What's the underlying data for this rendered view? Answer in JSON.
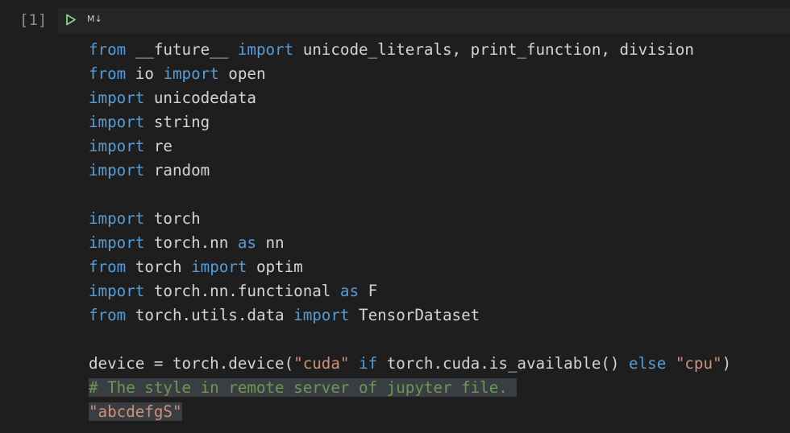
{
  "cell": {
    "execution_count": "[1]",
    "run_icon": "play-icon",
    "cell_type_label": "M↓",
    "colors": {
      "keyword": "#569cd6",
      "string": "#ce9178",
      "comment": "#6a9955",
      "text": "#d4d4d4"
    },
    "lines": [
      {
        "selected": false,
        "tokens": [
          {
            "t": "from",
            "k": "kw"
          },
          {
            "t": " __future__ ",
            "k": ""
          },
          {
            "t": "import",
            "k": "kw"
          },
          {
            "t": " unicode_literals, print_function, division",
            "k": ""
          }
        ]
      },
      {
        "selected": false,
        "tokens": [
          {
            "t": "from",
            "k": "kw"
          },
          {
            "t": " io ",
            "k": ""
          },
          {
            "t": "import",
            "k": "kw"
          },
          {
            "t": " open",
            "k": ""
          }
        ]
      },
      {
        "selected": false,
        "tokens": [
          {
            "t": "import",
            "k": "kw"
          },
          {
            "t": " unicodedata",
            "k": ""
          }
        ]
      },
      {
        "selected": false,
        "tokens": [
          {
            "t": "import",
            "k": "kw"
          },
          {
            "t": " string",
            "k": ""
          }
        ]
      },
      {
        "selected": false,
        "tokens": [
          {
            "t": "import",
            "k": "kw"
          },
          {
            "t": " re",
            "k": ""
          }
        ]
      },
      {
        "selected": false,
        "tokens": [
          {
            "t": "import",
            "k": "kw"
          },
          {
            "t": " random",
            "k": ""
          }
        ]
      },
      {
        "selected": false,
        "tokens": [
          {
            "t": "",
            "k": ""
          }
        ]
      },
      {
        "selected": false,
        "tokens": [
          {
            "t": "import",
            "k": "kw"
          },
          {
            "t": " torch",
            "k": ""
          }
        ]
      },
      {
        "selected": false,
        "tokens": [
          {
            "t": "import",
            "k": "kw"
          },
          {
            "t": " torch.nn ",
            "k": ""
          },
          {
            "t": "as",
            "k": "kw"
          },
          {
            "t": " nn",
            "k": ""
          }
        ]
      },
      {
        "selected": false,
        "tokens": [
          {
            "t": "from",
            "k": "kw"
          },
          {
            "t": " torch ",
            "k": ""
          },
          {
            "t": "import",
            "k": "kw"
          },
          {
            "t": " optim",
            "k": ""
          }
        ]
      },
      {
        "selected": false,
        "tokens": [
          {
            "t": "import",
            "k": "kw"
          },
          {
            "t": " torch.nn.functional ",
            "k": ""
          },
          {
            "t": "as",
            "k": "kw"
          },
          {
            "t": " F",
            "k": ""
          }
        ]
      },
      {
        "selected": false,
        "tokens": [
          {
            "t": "from",
            "k": "kw"
          },
          {
            "t": " torch.utils.data ",
            "k": ""
          },
          {
            "t": "import",
            "k": "kw"
          },
          {
            "t": " TensorDataset",
            "k": ""
          }
        ]
      },
      {
        "selected": false,
        "tokens": [
          {
            "t": "",
            "k": ""
          }
        ]
      },
      {
        "selected": false,
        "tokens": [
          {
            "t": "device = torch.device(",
            "k": ""
          },
          {
            "t": "\"cuda\"",
            "k": "str"
          },
          {
            "t": " ",
            "k": ""
          },
          {
            "t": "if",
            "k": "kw"
          },
          {
            "t": " torch.cuda.is_available() ",
            "k": ""
          },
          {
            "t": "else",
            "k": "kw"
          },
          {
            "t": " ",
            "k": ""
          },
          {
            "t": "\"cpu\"",
            "k": "str"
          },
          {
            "t": ")",
            "k": ""
          }
        ]
      },
      {
        "selected": true,
        "tokens": [
          {
            "t": "# The style in remote server of jupyter file. ",
            "k": "cmt"
          }
        ]
      },
      {
        "selected": true,
        "tokens": [
          {
            "t": "\"abcdefgS\"",
            "k": "str"
          }
        ]
      }
    ]
  }
}
